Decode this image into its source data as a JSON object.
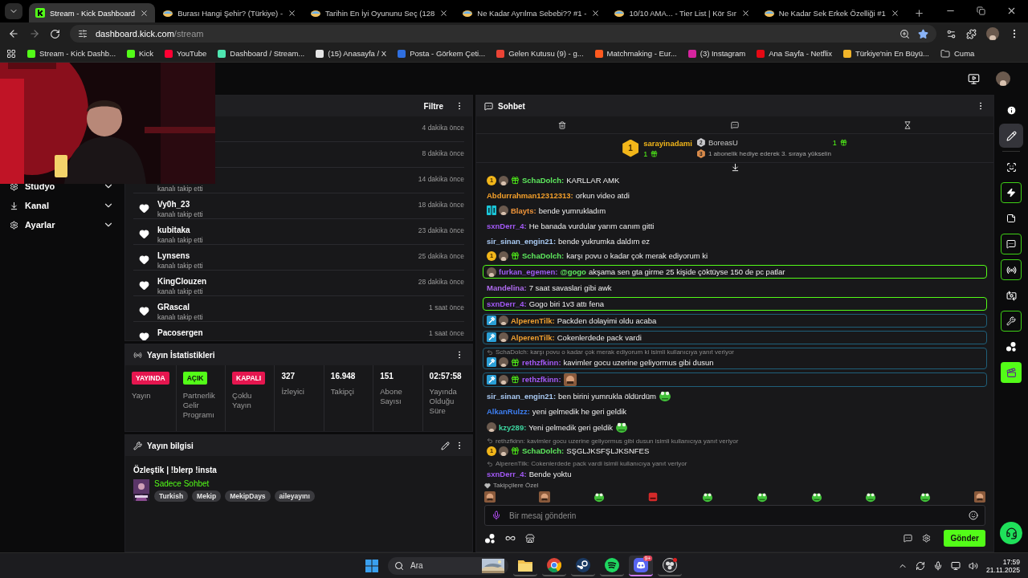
{
  "browser": {
    "tabs": [
      {
        "title": "Stream - Kick Dashboard",
        "kind": "kick",
        "selected": true
      },
      {
        "title": "Burası Hangi Şehir? (Türkiye) -",
        "kind": "video",
        "selected": false
      },
      {
        "title": "Tarihin En İyi Oyununu Seç (128",
        "kind": "video",
        "selected": false
      },
      {
        "title": "Ne Kadar Ayrılma Sebebi?? #1 -",
        "kind": "video",
        "selected": false
      },
      {
        "title": "10/10 AMA... - Tier List | Kör Sır",
        "kind": "video",
        "selected": false
      },
      {
        "title": "Ne Kadar Sek Erkek Özelliği #1",
        "kind": "video",
        "selected": false
      }
    ],
    "url_host": "dashboard.kick.com",
    "url_path": "/stream",
    "bookmarks": [
      {
        "label": "Stream - Kick Dashb...",
        "kind": "site",
        "color": "#53fc18"
      },
      {
        "label": "Kick",
        "kind": "site",
        "color": "#53fc18"
      },
      {
        "label": "YouTube",
        "kind": "site",
        "color": "#ff0033"
      },
      {
        "label": "Dashboard / Stream...",
        "kind": "site",
        "color": "#4ee6b0"
      },
      {
        "label": "(15) Anasayfa / X",
        "kind": "site",
        "color": "#e6e6e6"
      },
      {
        "label": "Posta - Görkem Çeti...",
        "kind": "site",
        "color": "#2f6fe0"
      },
      {
        "label": "Gelen Kutusu (9) - g...",
        "kind": "site",
        "color": "#ea4335"
      },
      {
        "label": "Matchmaking - Eur...",
        "kind": "site",
        "color": "#ff5a1f"
      },
      {
        "label": "(3) Instagram",
        "kind": "site",
        "color": "#d6249f"
      },
      {
        "label": "Ana Sayfa - Netflix",
        "kind": "site",
        "color": "#e50914"
      },
      {
        "label": "Türkiye'nin En Büyü...",
        "kind": "site",
        "color": "#f0b429"
      },
      {
        "label": "Cuma",
        "kind": "folder"
      }
    ]
  },
  "sidebar": {
    "items": [
      {
        "label": "Stüdyo"
      },
      {
        "label": "Kanal"
      },
      {
        "label": "Ayarlar"
      }
    ]
  },
  "followers": {
    "filter": "Filtre",
    "rows": [
      {
        "time": "4 dakika önce"
      },
      {
        "time": "8 dakika önce"
      },
      {
        "action": "kanalı takip etti",
        "time": "14 dakika önce"
      },
      {
        "name": "Vy0h_23",
        "action": "kanalı takip etti",
        "time": "18 dakika önce"
      },
      {
        "name": "kubitaka",
        "action": "kanalı takip etti",
        "time": "23 dakika önce"
      },
      {
        "name": "Lynsens",
        "action": "kanalı takip etti",
        "time": "25 dakika önce"
      },
      {
        "name": "KingClouzen",
        "action": "kanalı takip etti",
        "time": "28 dakika önce"
      },
      {
        "name": "GRascal",
        "action": "kanalı takip etti",
        "time": "1 saat önce"
      },
      {
        "name": "Pacosergen",
        "time": "1 saat önce"
      }
    ]
  },
  "stats": {
    "title": "Yayın İstatistikleri",
    "cells": [
      {
        "kind": "badge",
        "value": "YAYINDA",
        "color": "#e5164f",
        "label": "Yayın"
      },
      {
        "kind": "badge",
        "value": "AÇIK",
        "color": "#53fc18",
        "label": "Partnerlik Gelir Programı"
      },
      {
        "kind": "badge",
        "value": "KAPALI",
        "color": "#e5164f",
        "label": "Çoklu Yayın"
      },
      {
        "kind": "number",
        "value": "327",
        "label": "İzleyici"
      },
      {
        "kind": "number",
        "value": "16.948",
        "label": "Takipçi"
      },
      {
        "kind": "number",
        "value": "151",
        "label": "Abone Sayısı"
      },
      {
        "kind": "number",
        "value": "02:57:58",
        "label": "Yayında Olduğu Süre"
      }
    ]
  },
  "stream_info": {
    "header": "Yayın bilgisi",
    "title": "Özleştik | !blerp !insta",
    "category": "Sadece Sohbet",
    "tags": [
      "Turkish",
      "Mekip",
      "MekipDays",
      "aileyayını"
    ]
  },
  "chat": {
    "title": "Sohbet",
    "gifters": [
      {
        "rank": "1",
        "name": "sarayinadami",
        "count": "1"
      },
      {
        "rank": "2",
        "name": "BoreasU",
        "count": "1"
      },
      {
        "rank": "3",
        "prompt": "1 abonelik hediye ederek 3. sıraya yükselin"
      }
    ],
    "messages": [
      {
        "badges": [
          {
            "kind": "rank",
            "label": "1"
          },
          {
            "kind": "avatar"
          },
          {
            "kind": "sub"
          }
        ],
        "user": "SchaDolch:",
        "color": "#5ee85e",
        "text": "KARLLAR AMK",
        "highlighted": false
      },
      {
        "user": "Abdurrahman12312313:",
        "color": "#f5a02a",
        "text": "orkun video atdi",
        "highlighted": false
      },
      {
        "badges": [
          {
            "kind": "og"
          },
          {
            "kind": "avatar"
          }
        ],
        "user": "Blayts:",
        "color": "#f0953a",
        "text": "bende yumrukladım",
        "highlighted": false
      },
      {
        "user": "sxnDerr_4:",
        "color": "#a259f5",
        "text": "He banada vurdular yarım canım gitti",
        "highlighted": false
      },
      {
        "user": "sir_sinan_engin21:",
        "color": "#a9c9f2",
        "text": "bende yukrumka daldım ez",
        "highlighted": false
      },
      {
        "badges": [
          {
            "kind": "rank",
            "label": "1"
          },
          {
            "kind": "avatar"
          },
          {
            "kind": "sub"
          }
        ],
        "user": "SchaDolch:",
        "color": "#5ee85e",
        "text": "karşı povu o kadar çok merak ediyorum ki",
        "highlighted": false
      },
      {
        "badges": [
          {
            "kind": "avatar"
          }
        ],
        "user": "furkan_egemen:",
        "color": "#9d5cf5",
        "mention": "@gogo",
        "text": "akşama sen gta girme 25 kişide çöktüyse 150 de pc patlar",
        "highlighted": true
      },
      {
        "user": "Mandelina:",
        "color": "#b06cf0",
        "text": "7 saat savaslari gibi awk",
        "highlighted": false
      },
      {
        "user": "sxnDerr_4:",
        "color": "#a259f5",
        "text": "Gogo biri 1v3 attı fena",
        "highlighted": true
      },
      {
        "badges": [
          {
            "kind": "mod"
          },
          {
            "kind": "avatar"
          }
        ],
        "user": "AlperenTilk:",
        "color": "#f0a030",
        "text": "Packden dolayimi oldu acaba",
        "highlighted": false
      },
      {
        "badges": [
          {
            "kind": "mod"
          },
          {
            "kind": "avatar"
          }
        ],
        "user": "AlperenTilk:",
        "color": "#f0a030",
        "text": "Cokenlerdede pack vardi",
        "highlighted": false
      },
      {
        "reply_to": "SchaDolch: karşı povu o kadar çok merak ediyorum ki isimli kullanıcıya yanıt veriyor",
        "badges": [
          {
            "kind": "mod"
          },
          {
            "kind": "avatar"
          },
          {
            "kind": "sub"
          }
        ],
        "user": "rethzfkinn:",
        "color": "#a259f5",
        "text": "kavimler gocu uzerine geliyormus gibi dusun",
        "highlighted": false
      },
      {
        "badges": [
          {
            "kind": "mod"
          },
          {
            "kind": "avatar"
          },
          {
            "kind": "sub"
          }
        ],
        "user": "rethzfkinn:",
        "color": "#a259f5",
        "emote": {
          "kind": "face"
        },
        "highlighted": false
      },
      {
        "user": "sir_sinan_engin21:",
        "color": "#a9c9f2",
        "text": "ben birini yumrukla öldürdüm",
        "emote": {
          "kind": "frog"
        },
        "highlighted": false
      },
      {
        "user": "AlkanRulzz:",
        "color": "#3d7ef0",
        "text": "yeni gelmedik he geri geldik",
        "highlighted": false
      },
      {
        "badges": [
          {
            "kind": "avatar"
          }
        ],
        "user": "kzy289:",
        "color": "#3dd6a0",
        "text": "Yeni gelmedik geri geldik",
        "emote": {
          "kind": "frog"
        },
        "highlighted": false
      },
      {
        "reply_to": "rethzfkinn: kavimler gocu uzerine geliyormus gibi dusun isimli kullanıcıya yanıt veriyor",
        "badges": [
          {
            "kind": "rank",
            "label": "1"
          },
          {
            "kind": "avatar"
          },
          {
            "kind": "sub"
          }
        ],
        "user": "SchaDolch:",
        "color": "#5ee85e",
        "text": "SŞGLJKSFŞLJKSNFES",
        "highlighted": false
      },
      {
        "reply_to": "AlperenTilk: Cokenlerdede pack vardi isimli kullanıcıya yanıt veriyor",
        "user": "sxnDerr_4:",
        "color": "#a259f5",
        "text": "Bende yoktu",
        "highlighted": false
      }
    ],
    "followers_only": "Takipçilere Özel",
    "emotes": [
      {
        "kind": "face"
      },
      {
        "kind": "face"
      },
      {
        "kind": "frog"
      },
      {
        "kind": "red"
      },
      {
        "kind": "frog"
      },
      {
        "kind": "frog"
      },
      {
        "kind": "frog"
      },
      {
        "kind": "frog"
      },
      {
        "kind": "frog"
      },
      {
        "kind": "face"
      }
    ],
    "input": {
      "placeholder": "Bir mesaj gönderin"
    },
    "send": "Gönder"
  },
  "rail": [
    {
      "kind": "info",
      "selected": false
    },
    {
      "kind": "edit",
      "selected": true
    },
    {
      "kind": "focus",
      "selected": false
    },
    {
      "kind": "bolt",
      "selected": false
    },
    {
      "kind": "notes",
      "selected": false
    },
    {
      "kind": "chat",
      "selected": false
    },
    {
      "kind": "broadcast",
      "selected": false
    },
    {
      "kind": "camera",
      "selected": false
    },
    {
      "kind": "wrench",
      "selected": false
    },
    {
      "kind": "circles",
      "selected": false
    },
    {
      "kind": "clapper",
      "selected": false
    }
  ],
  "taskbar": {
    "search_placeholder": "Ara",
    "apps": [
      {
        "kind": "folder",
        "selected": false
      },
      {
        "kind": "browser",
        "selected": false
      },
      {
        "kind": "steam",
        "selected": false
      },
      {
        "kind": "spotify",
        "selected": false
      },
      {
        "kind": "discord",
        "selected": true,
        "badge": "9+"
      },
      {
        "kind": "recorder",
        "selected": false
      }
    ],
    "time": "17:59",
    "date": "21.11.2025"
  }
}
